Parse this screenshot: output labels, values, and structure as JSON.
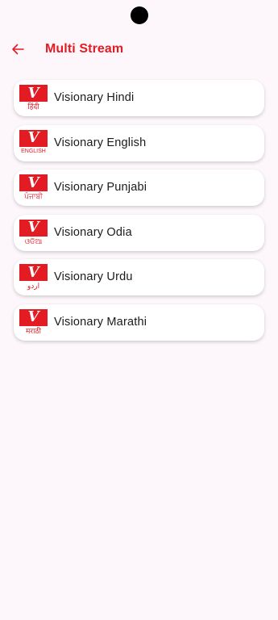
{
  "header": {
    "title": "Multi Stream",
    "back_icon": "arrow-left-icon"
  },
  "colors": {
    "accent": "#e31b23",
    "background": "#fdf7fb",
    "card": "#ffffff",
    "text": "#1a1a1a"
  },
  "streams": [
    {
      "label": "Visionary Hindi",
      "logo_letter": "V",
      "logo_lang": "हिंदी"
    },
    {
      "label": "Visionary English",
      "logo_letter": "V",
      "logo_lang": "ENGLISH"
    },
    {
      "label": "Visionary Punjabi",
      "logo_letter": "V",
      "logo_lang": "ਪੰਜਾਬੀ"
    },
    {
      "label": "Visionary Odia",
      "logo_letter": "V",
      "logo_lang": "ଓଡିଆ"
    },
    {
      "label": "Visionary Urdu",
      "logo_letter": "V",
      "logo_lang": "اردو"
    },
    {
      "label": "Visionary Marathi",
      "logo_letter": "V",
      "logo_lang": "मराठी"
    }
  ]
}
